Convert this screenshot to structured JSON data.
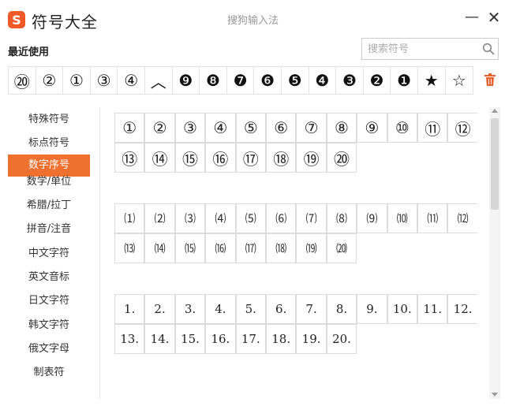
{
  "app": {
    "title": "符号大全",
    "ime_name": "搜狗输入法",
    "minimize_label": "—",
    "close_label": "✕"
  },
  "recent": {
    "label": "最近使用",
    "symbols": [
      "⑳",
      "②",
      "①",
      "③",
      "④",
      "︿",
      "❾",
      "❽",
      "❼",
      "❻",
      "❺",
      "❹",
      "❸",
      "❷",
      "❶",
      "★",
      "☆"
    ]
  },
  "search": {
    "placeholder": "搜索符号",
    "value": ""
  },
  "sidebar": {
    "items": [
      "特殊符号",
      "标点符号",
      "数字序号",
      "数学/单位",
      "希腊/拉丁",
      "拼音/注音",
      "中文字符",
      "英文音标",
      "日文字符",
      "韩文字符",
      "俄文字母",
      "制表符"
    ],
    "active_index": 2
  },
  "grids": {
    "circled": [
      "①",
      "②",
      "③",
      "④",
      "⑤",
      "⑥",
      "⑦",
      "⑧",
      "⑨",
      "⑩",
      "⑪",
      "⑫",
      "⑬",
      "⑭",
      "⑮",
      "⑯",
      "⑰",
      "⑱",
      "⑲",
      "⑳"
    ],
    "parenthesized": [
      "⑴",
      "⑵",
      "⑶",
      "⑷",
      "⑸",
      "⑹",
      "⑺",
      "⑻",
      "⑼",
      "⑽",
      "⑾",
      "⑿",
      "⒀",
      "⒁",
      "⒂",
      "⒃",
      "⒄",
      "⒅",
      "⒆",
      "⒇"
    ],
    "period": [
      "1.",
      "2.",
      "3.",
      "4.",
      "5.",
      "6.",
      "7.",
      "8.",
      "9.",
      "10.",
      "11.",
      "12.",
      "13.",
      "14.",
      "15.",
      "16.",
      "17.",
      "18.",
      "19.",
      "20."
    ]
  },
  "colors": {
    "accent": "#f07030",
    "trash": "#e8602c"
  }
}
